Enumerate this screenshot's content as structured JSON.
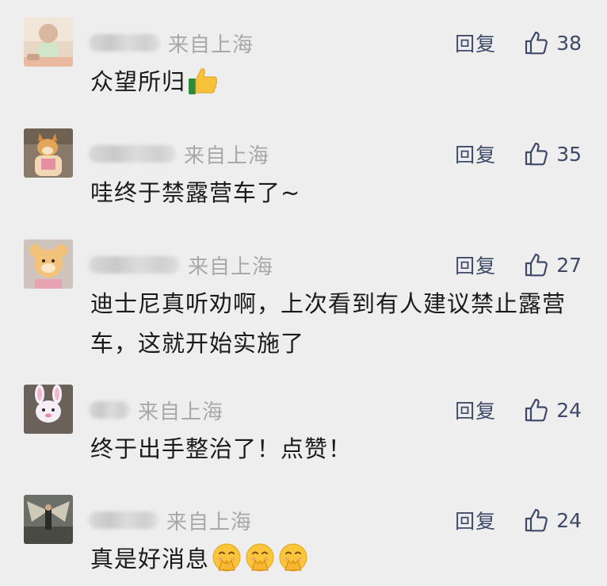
{
  "comments": [
    {
      "location": "来自上海",
      "reply_label": "回复",
      "likes": "38",
      "text": "众望所归",
      "emoji": "thumbs-up",
      "avatar_desc": "baby-photo"
    },
    {
      "location": "来自上海",
      "reply_label": "回复",
      "likes": "35",
      "text": "哇终于禁露营车了~",
      "avatar_desc": "shiba-dog-photo"
    },
    {
      "location": "来自上海",
      "reply_label": "回复",
      "likes": "27",
      "text": "迪士尼真听劝啊，上次看到有人建议禁止露营车，这就开始实施了",
      "avatar_desc": "plush-character-photo"
    },
    {
      "location": "来自上海",
      "reply_label": "回复",
      "likes": "24",
      "text": "终于出手整治了！点赞！",
      "avatar_desc": "bunny-character-photo"
    },
    {
      "location": "来自上海",
      "reply_label": "回复",
      "likes": "24",
      "text": "真是好消息",
      "emoji": "hand-over-mouth-face ×3",
      "avatar_desc": "winged-figure-photo"
    }
  ],
  "colors": {
    "background": "#eeeeee",
    "action_text": "#3f4a68",
    "location_text": "#a8a8a8",
    "body_text": "#1a1a1a"
  }
}
